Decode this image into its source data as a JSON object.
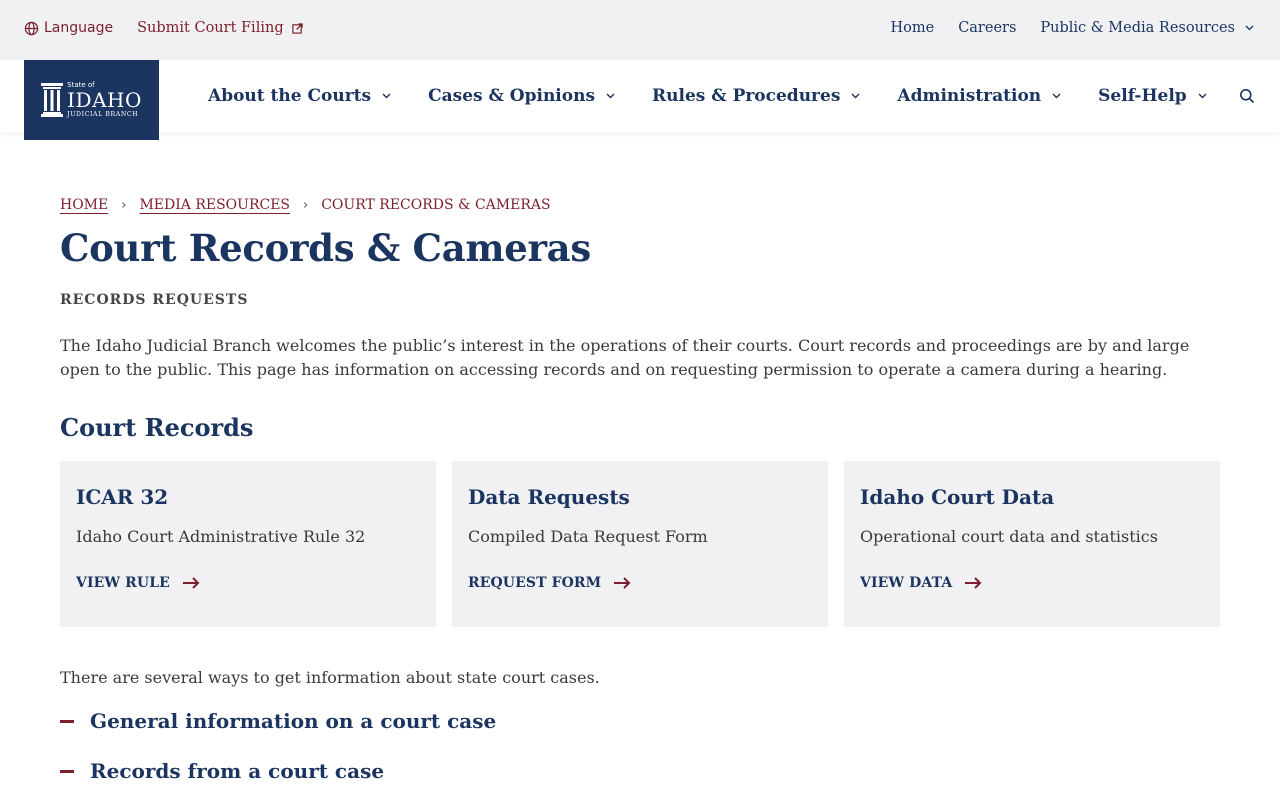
{
  "utility": {
    "language_label": "Language",
    "submit_filing_label": "Submit Court Filing",
    "right_links": [
      {
        "label": "Home"
      },
      {
        "label": "Careers"
      },
      {
        "label": "Public & Media Resources"
      }
    ]
  },
  "logo": {
    "state_text": "State of",
    "idaho_text": "IDAHO",
    "branch_text": "JUDICIAL BRANCH"
  },
  "nav": {
    "items": [
      {
        "label": "About the Courts"
      },
      {
        "label": "Cases & Opinions"
      },
      {
        "label": "Rules & Procedures"
      },
      {
        "label": "Administration"
      },
      {
        "label": "Self-Help"
      }
    ]
  },
  "breadcrumb": {
    "home": "HOME",
    "media": "MEDIA RESOURCES",
    "current": "COURT RECORDS & CAMERAS"
  },
  "page": {
    "title": "Court Records & Cameras",
    "eyebrow": "RECORDS REQUESTS",
    "intro": "The Idaho Judicial Branch welcomes the public’s interest in the operations of their courts. Court records and proceedings are by and large open to the public. This page has information on accessing records and on requesting permission to operate a camera during a hearing.",
    "section_title": "Court Records"
  },
  "cards": [
    {
      "title": "ICAR 32",
      "description": "Idaho Court Administrative Rule 32",
      "link": "VIEW RULE"
    },
    {
      "title": "Data Requests",
      "description": "Compiled Data Request Form",
      "link": "REQUEST FORM"
    },
    {
      "title": "Idaho Court Data",
      "description": "Operational court data and statistics",
      "link": "VIEW DATA"
    }
  ],
  "cases": {
    "intro": "There are several ways to get information about state court cases.",
    "accordions": [
      {
        "label": "General information on a court case"
      },
      {
        "label": "Records from a court case"
      }
    ]
  },
  "colors": {
    "navy": "#1b3560",
    "maroon": "#7a1f2b",
    "light_gray": "#f1f1f3"
  }
}
